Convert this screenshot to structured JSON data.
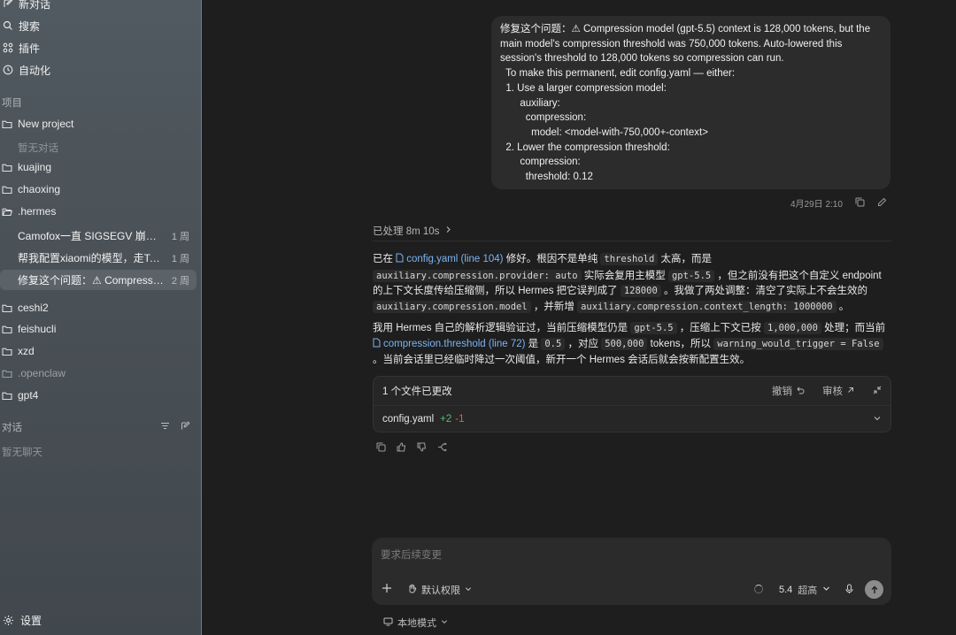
{
  "sidebar": {
    "nav": [
      {
        "label": "新对话",
        "icon": "new-chat-icon"
      },
      {
        "label": "搜索",
        "icon": "search-icon"
      },
      {
        "label": "插件",
        "icon": "plugins-icon"
      },
      {
        "label": "自动化",
        "icon": "clock-icon"
      }
    ],
    "projects_title": "项目",
    "projects": [
      {
        "label": "New project",
        "icon": "folder-icon"
      },
      {
        "label": "kuajing",
        "icon": "folder-icon"
      },
      {
        "label": "chaoxing",
        "icon": "folder-icon"
      },
      {
        "label": ".hermes",
        "icon": "folder-open-icon"
      },
      {
        "label": "ceshi2",
        "icon": "folder-icon"
      },
      {
        "label": "feishucli",
        "icon": "folder-icon"
      },
      {
        "label": "xzd",
        "icon": "folder-icon"
      },
      {
        "label": ".openclaw",
        "icon": "folder-icon"
      },
      {
        "label": "gpt4",
        "icon": "folder-icon"
      }
    ],
    "new_project_empty": "暂无对话",
    "hermes_conversations": [
      {
        "title": "Camofox一直 SIGSEGV 崩溃。…",
        "age": "1 周"
      },
      {
        "title": "帮我配置xiaomi的模型，走Toke…",
        "age": "1 周"
      },
      {
        "title": "修复这个问题：⚠ Compression…",
        "age": "2 周",
        "active": true
      }
    ],
    "chats_title": "对话",
    "chats_empty": "暂无聊天",
    "settings_label": "设置"
  },
  "message": {
    "user_text": "修复这个问题：⚠ Compression model (gpt-5.5) context is 128,000 tokens, but the\nmain model's compression threshold was 750,000 tokens. Auto-lowered this\nsession's threshold to 128,000 tokens so compression can run.\n  To make this permanent, edit config.yaml — either:\n  1. Use a larger compression model:\n       auxiliary:\n         compression:\n           model: <model-with-750,000+-context>\n  2. Lower the compression threshold:\n       compression:\n         threshold: 0.12",
    "timestamp": "4月29日 2:10"
  },
  "answer": {
    "processed": "已处理 8m 10s",
    "p1": {
      "t1": "已在 ",
      "link1": "config.yaml (line 104)",
      "t2": " 修好。根因不是单纯 ",
      "c1": "threshold",
      "t3": " 太高，而是",
      "c2": "auxiliary.compression.provider: auto",
      "t4": " 实际会复用主模型 ",
      "c3": "gpt-5.5",
      "t5": " ，但之前没有把这个自定义 endpoint 的上下文长度传给压缩侧，所以 Hermes 把它误判成了 ",
      "c4": "128000",
      "t6": " 。我做了两处调整：清空了实际上不会生效的 ",
      "c5": "auxiliary.compression.model",
      "t7": " ，并新增 ",
      "c6": "auxiliary.compression.context_length: 1000000",
      "t8": " 。"
    },
    "p2": {
      "t1": "我用 Hermes 自己的解析逻辑验证过，当前压缩模型仍是 ",
      "c1": "gpt-5.5",
      "t2": " ，压缩上下文已按 ",
      "c2": "1,000,000",
      "t3": " 处理；而当前",
      "link1": "compression.threshold (line 72)",
      "t4": " 是 ",
      "c3": "0.5",
      "t5": " ，对应 ",
      "c4": "500,000",
      "t6": " tokens，所以 ",
      "c5": "warning_would_trigger = False",
      "t7": " 。当前会话里已经临时降过一次阈值，新开一个 Hermes 会话后就会按新配置生效。"
    }
  },
  "changes": {
    "title": "1 个文件已更改",
    "undo": "撤销",
    "review": "审核",
    "file": "config.yaml",
    "added": "+2",
    "removed": "-1"
  },
  "composer": {
    "placeholder": "要求后续变更",
    "permission": "默认权限",
    "model": "5.4",
    "effort": "超高",
    "local_mode": "本地模式"
  }
}
